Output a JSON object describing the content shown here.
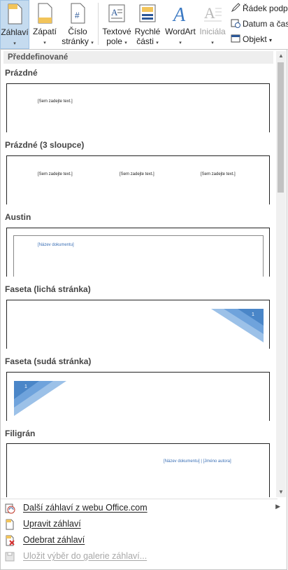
{
  "ribbon": {
    "buttons": [
      {
        "label1": "Záhlaví",
        "label2": ""
      },
      {
        "label1": "Zápatí",
        "label2": ""
      },
      {
        "label1": "Číslo",
        "label2": "stránky"
      },
      {
        "label1": "Textové",
        "label2": "pole"
      },
      {
        "label1": "Rychlé",
        "label2": "části"
      },
      {
        "label1": "WordArt",
        "label2": ""
      },
      {
        "label1": "Iniciála",
        "label2": ""
      }
    ],
    "small_items": [
      "Řádek podpi",
      "Datum a čas",
      "Objekt"
    ]
  },
  "panel": {
    "header": "Předdefinované",
    "items": [
      {
        "title": "Prázdné",
        "placeholder": "[Sem zadejte text.]"
      },
      {
        "title": "Prázdné (3 sloupce)",
        "placeholder": "[Sem zadejte text.]"
      },
      {
        "title": "Austin",
        "placeholder": "[Název dokumentu]"
      },
      {
        "title": "Faseta (lichá stránka)",
        "placeholder": "1"
      },
      {
        "title": "Faseta (sudá stránka)",
        "placeholder": "1"
      },
      {
        "title": "Filigrán",
        "placeholder": "[Název dokumentu] | [Jméno autora]"
      }
    ]
  },
  "menu": [
    {
      "label": "Další záhlaví z webu Office.com",
      "icon": "office-web-icon",
      "disabled": false
    },
    {
      "label": "Upravit záhlaví",
      "icon": "edit-header-icon",
      "disabled": false
    },
    {
      "label": "Odebrat záhlaví",
      "icon": "remove-header-icon",
      "disabled": false
    },
    {
      "label": "Uložit výběr do galerie záhlaví...",
      "icon": "save-selection-icon",
      "disabled": true
    }
  ],
  "colors": {
    "accent": "#4a86c8",
    "active_bg": "#c5dbef"
  }
}
